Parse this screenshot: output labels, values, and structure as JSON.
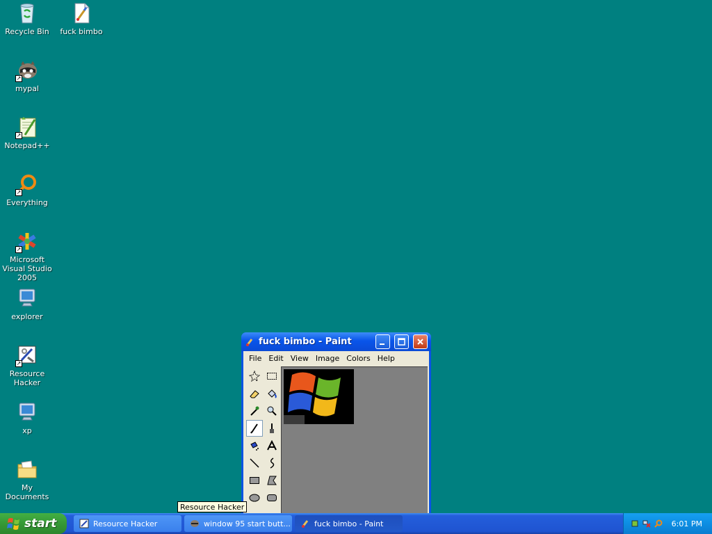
{
  "desktop": {
    "icons": [
      {
        "label": "Recycle Bin"
      },
      {
        "label": "fuck bimbo"
      },
      {
        "label": "mypal"
      },
      {
        "label": "Notepad++"
      },
      {
        "label": "Everything"
      },
      {
        "label": "Microsoft Visual Studio 2005"
      },
      {
        "label": "explorer"
      },
      {
        "label": "Resource Hacker"
      },
      {
        "label": "xp"
      },
      {
        "label": "My Documents"
      }
    ]
  },
  "window": {
    "title": "fuck bimbo - Paint",
    "menu": [
      "File",
      "Edit",
      "View",
      "Image",
      "Colors",
      "Help"
    ]
  },
  "tooltip": {
    "text": "Resource Hacker"
  },
  "taskbar": {
    "start_label": "start",
    "buttons": [
      {
        "label": "Resource Hacker"
      },
      {
        "label": "window 95 start butt..."
      },
      {
        "label": "fuck bimbo - Paint"
      }
    ],
    "clock": "6:01 PM"
  }
}
